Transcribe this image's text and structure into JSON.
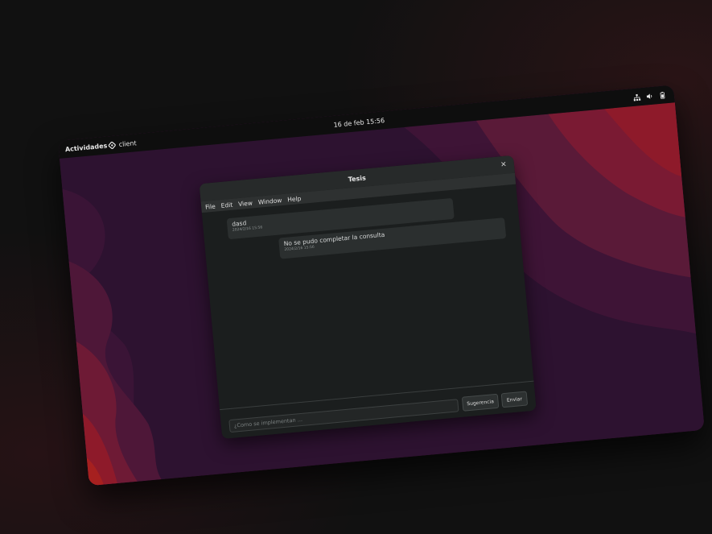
{
  "topbar": {
    "activities": "Actividades",
    "app_name": "client",
    "clock": "16 de feb  15:56",
    "tray_icons": [
      "network-icon",
      "volume-icon",
      "battery-icon"
    ]
  },
  "window": {
    "title": "Tesis",
    "menu": [
      "File",
      "Edit",
      "View",
      "Window",
      "Help"
    ]
  },
  "messages": [
    {
      "text": "dasd",
      "time": "2024/2/16 15:56"
    },
    {
      "text": "No se pudo completar la consulta",
      "time": "2024/2/16 15:56"
    }
  ],
  "input": {
    "placeholder": "¿Como se implementan ...",
    "value": ""
  },
  "buttons": {
    "suggest": "Sugerencia",
    "send": "Enviar"
  },
  "colors": {
    "wallpaper_dark": "#2a1030",
    "wallpaper_mid": "#5a1a38",
    "wallpaper_red": "#8e1a2a",
    "wallpaper_bright": "#a6201f"
  }
}
